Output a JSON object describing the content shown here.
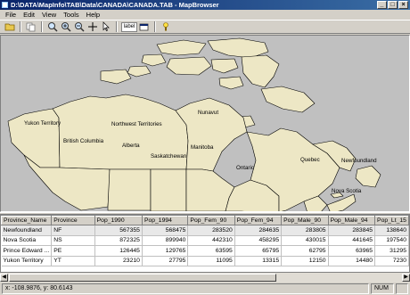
{
  "window": {
    "title": "D:\\DATA\\MapInfo\\TAB\\Data\\CANADA\\CANADA.TAB - MapBrowser",
    "minimize": "_",
    "maximize": "□",
    "close": "×"
  },
  "menu": [
    "File",
    "Edit",
    "View",
    "Tools",
    "Help"
  ],
  "toolbar": {
    "icons": [
      "open-folder-icon",
      "copy-icon",
      "zoom-icon",
      "zoom-in-icon",
      "zoom-out-icon",
      "pan-icon",
      "select-arrow-icon",
      "label-icon",
      "layer-control-icon",
      "info-icon"
    ],
    "label_text": "label"
  },
  "map": {
    "colors": {
      "land": "#ede7c5",
      "background": "#c0c0c0",
      "outline": "#000000"
    },
    "labels": {
      "nunavut": "Nunavut",
      "yukon": "Yukon Territory",
      "nwt": "Northwest Territories",
      "bc": "British Columbia",
      "alberta": "Alberta",
      "saskatchewan": "Saskatchewan",
      "manitoba": "Manitoba",
      "ontario": "Ontario",
      "quebec": "Quebec",
      "newfoundland": "Newfoundland",
      "nova_scotia": "Nova Scotia"
    }
  },
  "table": {
    "columns": [
      "Province_Name",
      "Province",
      "Pop_1990",
      "Pop_1994",
      "Pop_Fem_90",
      "Pop_Fem_94",
      "Pop_Male_90",
      "Pop_Male_94",
      "Pop_Lt_15"
    ],
    "rows": [
      [
        "Newfoundland",
        "NF",
        "567355",
        "568475",
        "283520",
        "284635",
        "283805",
        "283845",
        "138640"
      ],
      [
        "Nova Scotia",
        "NS",
        "872325",
        "899940",
        "442310",
        "458295",
        "430015",
        "441645",
        "197540"
      ],
      [
        "Prince Edward ...",
        "PE",
        "126445",
        "129765",
        "63595",
        "65795",
        "62795",
        "63965",
        "31295"
      ],
      [
        "Yukon Territory",
        "YT",
        "23210",
        "27795",
        "11095",
        "13315",
        "12150",
        "14480",
        "7230"
      ]
    ]
  },
  "status": {
    "coords": "x: -108.9876, y: 80.6143",
    "num": "NUM"
  }
}
